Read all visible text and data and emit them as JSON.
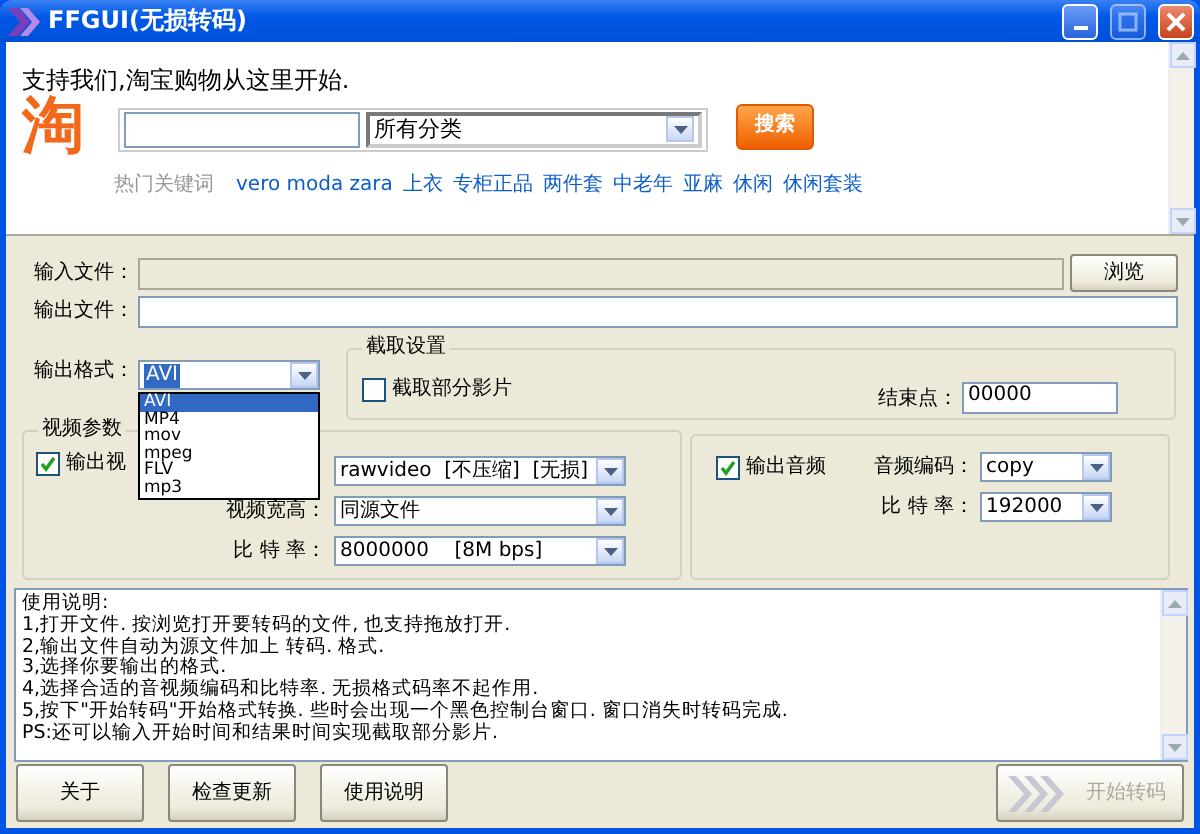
{
  "window": {
    "title": "FFGUI(无损转码)"
  },
  "ad": {
    "slogan": "支持我们,淘宝购物从这里开始.",
    "logo": "淘",
    "category": "所有分类",
    "search_button": "搜索",
    "hot_label": "热门关键词",
    "hot_links": [
      "vero moda zara",
      "上衣",
      "专柜正品",
      "两件套",
      "中老年",
      "亚麻",
      "休闲",
      "休闲套装"
    ]
  },
  "files": [
    {
      "label": "输入文件：",
      "disabled": true
    },
    {
      "label": "输出文件：",
      "disabled": false
    }
  ],
  "browse_button": "浏览",
  "format": {
    "label": "输出格式：",
    "value": "AVI",
    "options": [
      {
        "label": "AVI",
        "selected": true
      },
      {
        "label": "MP4",
        "selected": false
      },
      {
        "label": "mov",
        "selected": false
      },
      {
        "label": "mpeg",
        "selected": false
      },
      {
        "label": "FLV",
        "selected": false
      },
      {
        "label": "mp3",
        "selected": false
      }
    ]
  },
  "clip": {
    "title": "截取设置",
    "checkbox": {
      "label": "截取部分影片",
      "checked": false
    },
    "end_label": "结束点：",
    "end_value": "00000"
  },
  "video": {
    "title": "视频参数",
    "checkbox": {
      "label": "输出视",
      "checked": true
    },
    "rows": [
      {
        "value": "rawvideo  [不压缩]  [无损]"
      },
      {
        "label": "视频宽高：",
        "value": "同源文件"
      },
      {
        "label": "比 特 率：",
        "value": "8000000    [8M bps]"
      }
    ]
  },
  "audio": {
    "checkbox": {
      "label": "输出音频",
      "checked": true
    },
    "rows": [
      {
        "label": "音频编码：",
        "value": "copy"
      },
      {
        "label": "比 特 率：",
        "value": "192000"
      }
    ]
  },
  "instructions": [
    "使用说明:",
    "1,打开文件. 按浏览打开要转码的文件, 也支持拖放打开.",
    "2,输出文件自动为源文件加上 转码. 格式.",
    "3,选择你要输出的格式.",
    "4,选择合适的音视频编码和比特率. 无损格式码率不起作用.",
    "5,按下\"开始转码\"开始格式转换. 些时会出现一个黑色控制台窗口. 窗口消失时转码完成.",
    "PS:还可以输入开始时间和结果时间实现截取部分影片."
  ],
  "buttons": [
    {
      "label": "关于",
      "kind": "plain",
      "disabled": false
    },
    {
      "label": "检查更新",
      "kind": "plain",
      "disabled": false
    },
    {
      "label": "使用说明",
      "kind": "plain",
      "disabled": false
    },
    {
      "label": "开始转码",
      "kind": "start",
      "disabled": true
    }
  ]
}
